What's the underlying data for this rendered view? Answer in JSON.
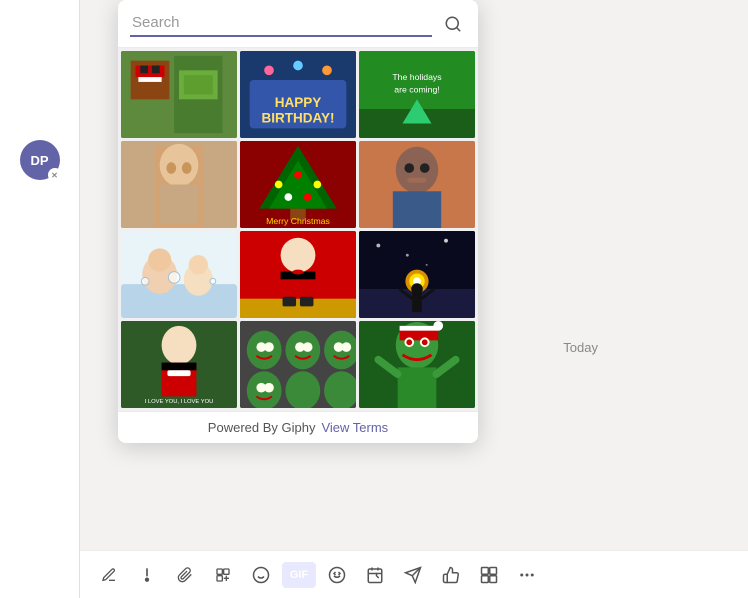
{
  "search": {
    "placeholder": "Search",
    "value": ""
  },
  "footer": {
    "powered_by": "Powered By Giphy",
    "view_terms": "View Terms"
  },
  "today_label": "Today",
  "avatar": {
    "initials": "DP"
  },
  "gifs": [
    {
      "id": 1,
      "label": "",
      "css_class": "gif-minecraft",
      "alt": "Minecraft Santa GIF"
    },
    {
      "id": 2,
      "label": "HAPPY BIRTHDAY!",
      "css_class": "gif-birthday",
      "alt": "Happy Birthday GIF"
    },
    {
      "id": 3,
      "label": "The holidays are coming!",
      "css_class": "gif-holidays",
      "alt": "Holidays GIF"
    },
    {
      "id": 4,
      "label": "",
      "css_class": "gif-shirtless",
      "alt": "Shirtless man GIF"
    },
    {
      "id": 5,
      "label": "Merry Christmas",
      "css_class": "gif-merry-xmas",
      "alt": "Merry Christmas GIF"
    },
    {
      "id": 6,
      "label": "",
      "css_class": "gif-will-smith",
      "alt": "Will Smith GIF"
    },
    {
      "id": 7,
      "label": "",
      "css_class": "gif-bath",
      "alt": "Bath GIF"
    },
    {
      "id": 8,
      "label": "",
      "css_class": "gif-santa-dance",
      "alt": "Santa Dance GIF"
    },
    {
      "id": 9,
      "label": "",
      "css_class": "gif-light-snow",
      "alt": "Light in snow GIF"
    },
    {
      "id": 10,
      "label": "I LOVE YOU, I LOVE YOU",
      "css_class": "gif-elf",
      "alt": "Elf movie GIF"
    },
    {
      "id": 11,
      "label": "",
      "css_class": "gif-grinch-heads",
      "alt": "Grinch heads GIF"
    },
    {
      "id": 12,
      "label": "",
      "css_class": "gif-grinch",
      "alt": "Grinch GIF"
    }
  ],
  "toolbar": {
    "buttons": [
      {
        "id": "format",
        "icon": "✏",
        "label": "Format"
      },
      {
        "id": "attach",
        "icon": "📎",
        "label": "Attach"
      },
      {
        "id": "emoji",
        "icon": "😊",
        "label": "Emoji"
      },
      {
        "id": "gif",
        "icon": "GIF",
        "label": "GIF",
        "active": true
      },
      {
        "id": "sticker",
        "icon": "🙂",
        "label": "Sticker"
      },
      {
        "id": "loop",
        "icon": "⟳",
        "label": "Loop"
      },
      {
        "id": "send",
        "icon": "▷",
        "label": "Send"
      },
      {
        "id": "like",
        "icon": "♡",
        "label": "Like"
      },
      {
        "id": "more",
        "icon": "•••",
        "label": "More options"
      }
    ]
  }
}
